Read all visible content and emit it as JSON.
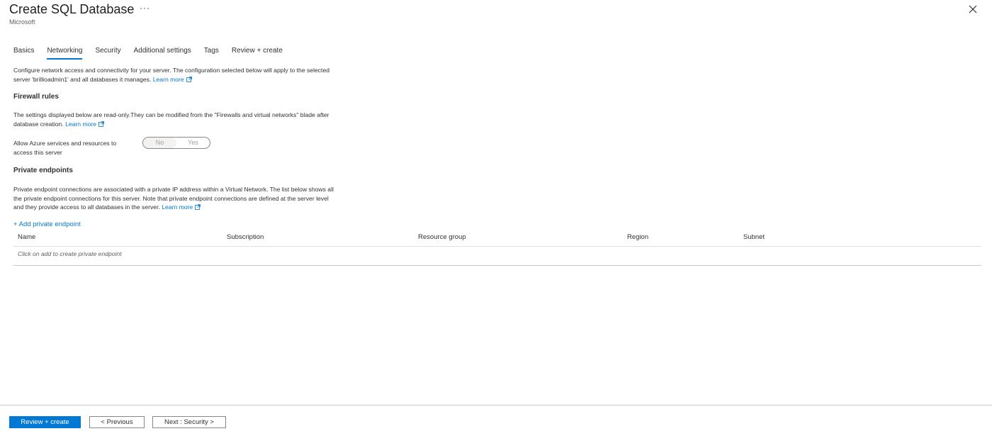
{
  "header": {
    "title": "Create SQL Database",
    "more": "···",
    "subtitle": "Microsoft"
  },
  "tabs": [
    {
      "label": "Basics",
      "active": false
    },
    {
      "label": "Networking",
      "active": true
    },
    {
      "label": "Security",
      "active": false
    },
    {
      "label": "Additional settings",
      "active": false
    },
    {
      "label": "Tags",
      "active": false
    },
    {
      "label": "Review + create",
      "active": false
    }
  ],
  "intro": {
    "line1": "Configure network access and connectivity for your server. The configuration selected below will apply to the selected",
    "line2": "server 'brillioadmin1' and all databases it manages.",
    "learn_more": "Learn more"
  },
  "firewall": {
    "heading": "Firewall rules",
    "line1": "The settings displayed below are read-only.They can be modified from the \"Firewalls and virtual networks\" blade after",
    "line2": "database creation.",
    "learn_more": "Learn more",
    "allow_label_line1": "Allow Azure services and resources to",
    "allow_label_line2": "access this server",
    "toggle": {
      "no": "No",
      "yes": "Yes",
      "selected": "No"
    }
  },
  "private_endpoints": {
    "heading": "Private endpoints",
    "line1": "Private endpoint connections are associated with a private IP address within a Virtual Network. The list below shows all",
    "line2": "the private endpoint connections for this server. Note that private endpoint connections are defined at the server level",
    "line3": "and they provide access to all databases in the server.",
    "learn_more": "Learn more",
    "add_link": "+ Add private endpoint",
    "columns": [
      "Name",
      "Subscription",
      "Resource group",
      "Region",
      "Subnet"
    ],
    "empty_message": "Click on add to create private endpoint"
  },
  "footer": {
    "review_create": "Review + create",
    "previous": "< Previous",
    "next": "Next : Security >"
  },
  "colors": {
    "accent": "#0078d4",
    "text": "#323130",
    "muted": "#605e5c"
  }
}
